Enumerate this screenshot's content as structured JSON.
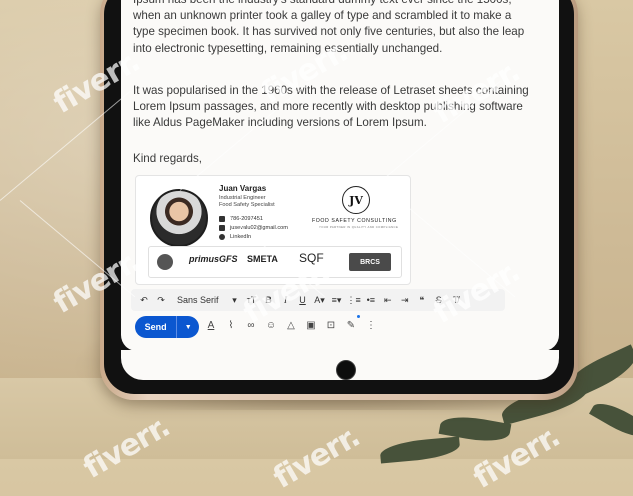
{
  "email": {
    "paragraph1": "Ipsum has been the industry's standard dummy text ever since the 1500s, when an unknown printer took a galley of type and scrambled it to make a type specimen book. It has survived not only five centuries, but also the leap into electronic typesetting, remaining essentially unchanged.",
    "paragraph2": "It was popularised in the 1960s with the release of Letraset sheets containing Lorem Ipsum passages, and more recently with desktop publishing software like Aldus PageMaker including versions of Lorem Ipsum.",
    "closing": "Kind regards,"
  },
  "signature": {
    "name": "Juan Vargas",
    "title1": "Industrial Engineer",
    "title2": "Food Safety Specialist",
    "phone": "786-2097451",
    "email": "jusevalu02@gmail.com",
    "linkedin": "LinkedIn",
    "logo_mark": "JV",
    "logo_text": "FOOD SAFETY CONSULTING",
    "logo_sub": "YOUR PARTNER IN QUALITY AND COMPLIANCE",
    "certs": [
      "primusGFS",
      "SMETA",
      "SQF",
      "BRCS"
    ]
  },
  "toolbar": {
    "font": "Sans Serif",
    "items": [
      "undo-icon",
      "redo-icon",
      "font-size-icon",
      "bold",
      "italic",
      "underline",
      "text-color-icon",
      "align-icon",
      "numbered-list-icon",
      "bulleted-list-icon",
      "indent-less-icon",
      "indent-more-icon",
      "quote-icon",
      "strikethrough",
      "remove-format-icon"
    ]
  },
  "send": {
    "label": "Send"
  },
  "watermark": "fiverr."
}
